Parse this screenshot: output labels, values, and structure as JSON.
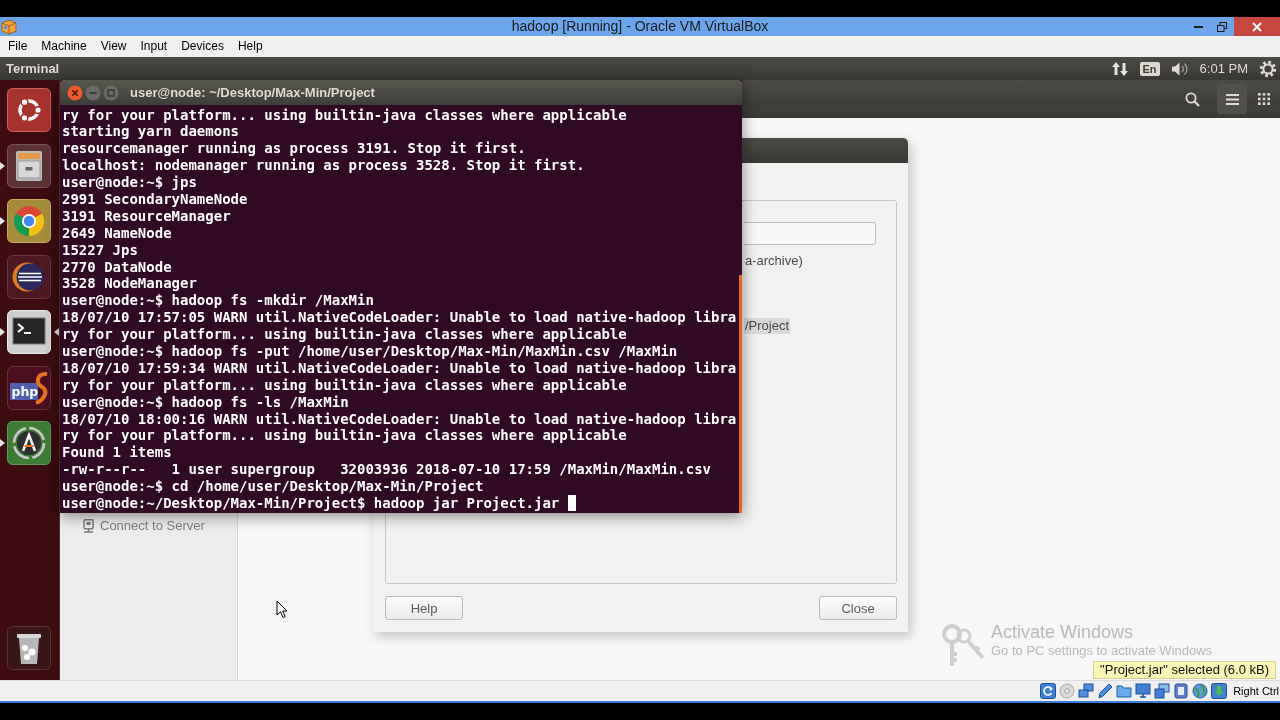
{
  "window": {
    "title": "hadoop [Running] - Oracle VM VirtualBox"
  },
  "menu": [
    "File",
    "Machine",
    "View",
    "Input",
    "Devices",
    "Help"
  ],
  "top_panel": {
    "app_name": "Terminal",
    "keyboard_layout": "En",
    "clock": "6:01 PM"
  },
  "launcher": [
    {
      "kind": "home",
      "running": false,
      "focused": false
    },
    {
      "kind": "files",
      "running": true,
      "focused": false
    },
    {
      "kind": "browser",
      "running": true,
      "focused": false
    },
    {
      "kind": "ide",
      "running": false,
      "focused": false
    },
    {
      "kind": "terminal",
      "running": true,
      "focused": true
    },
    {
      "kind": "php",
      "label": "php",
      "running": false,
      "focused": false
    },
    {
      "kind": "updater",
      "running": true,
      "focused": false
    },
    {
      "kind": "trash",
      "running": false,
      "focused": false
    }
  ],
  "files_window": {
    "sidebar_items": [
      "Connect to Server"
    ]
  },
  "properties_dialog": {
    "text_lines": [
      {
        "text": "a-archive)",
        "highlighted": false
      },
      {
        "text": "/Project",
        "highlighted": true
      }
    ],
    "buttons": [
      "Help",
      "Close"
    ]
  },
  "terminal": {
    "title": "user@node: ~/Desktop/Max-Min/Project",
    "lines": [
      "ry for your platform... using builtin-java classes where applicable",
      "starting yarn daemons",
      "resourcemanager running as process 3191. Stop it first.",
      "localhost: nodemanager running as process 3528. Stop it first.",
      "user@node:~$ jps",
      "2991 SecondaryNameNode",
      "3191 ResourceManager",
      "2649 NameNode",
      "15227 Jps",
      "2770 DataNode",
      "3528 NodeManager",
      "user@node:~$ hadoop fs -mkdir /MaxMin",
      "18/07/10 17:57:05 WARN util.NativeCodeLoader: Unable to load native-hadoop libra",
      "ry for your platform... using builtin-java classes where applicable",
      "user@node:~$ hadoop fs -put /home/user/Desktop/Max-Min/MaxMin.csv /MaxMin",
      "18/07/10 17:59:34 WARN util.NativeCodeLoader: Unable to load native-hadoop libra",
      "ry for your platform... using builtin-java classes where applicable",
      "user@node:~$ hadoop fs -ls /MaxMin",
      "18/07/10 18:00:16 WARN util.NativeCodeLoader: Unable to load native-hadoop libra",
      "ry for your platform... using builtin-java classes where applicable",
      "Found 1 items",
      "-rw-r--r--   1 user supergroup   32003936 2018-07-10 17:59 /MaxMin/MaxMin.csv",
      "user@node:~$ cd /home/user/Desktop/Max-Min/Project",
      "user@node:~/Desktop/Max-Min/Project$ hadoop jar Project.jar"
    ],
    "cursor": true
  },
  "activation_notice": {
    "title": "Activate Windows",
    "text": "Go to PC settings to activate Windows"
  },
  "status_bar": {
    "tooltip": "\"Project.jar\" selected (6.0 kB)",
    "host_key": "Right Ctrl"
  }
}
